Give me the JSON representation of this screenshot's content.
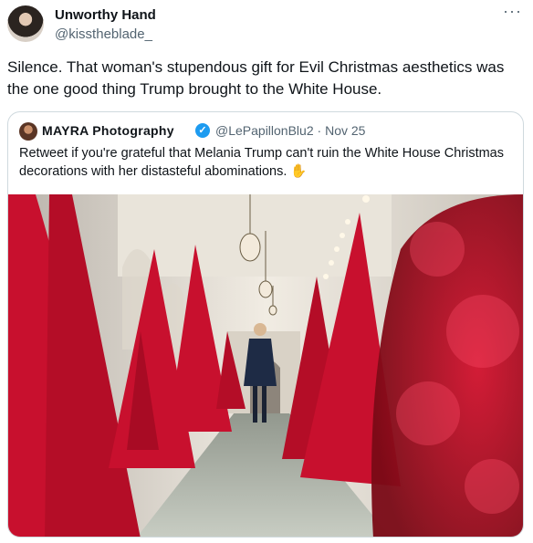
{
  "tweet": {
    "author_name": "Unworthy Hand",
    "author_handle": "@kisstheblade_",
    "more_icon": "more-horizontal-icon",
    "text": "Silence. That woman's stupendous gift for Evil Christmas aesthetics was the one good thing Trump brought to the White House."
  },
  "quoted_tweet": {
    "author_name": "MAYRA Photography",
    "verified_icon": "verified-badge-icon",
    "author_handle": "@LePapillonBlu2",
    "separator": "·",
    "date": "Nov 25",
    "text": "Retweet if you're grateful that Melania Trump can't ruin the White House Christmas decorations with her distasteful abominations.",
    "emoji_icon": "raised-hand-icon"
  },
  "colors": {
    "text_primary": "#0f1419",
    "text_secondary": "#536471",
    "border": "#cfd9de",
    "verified": "#1d9bf0",
    "tree_red": "#c8102e"
  }
}
